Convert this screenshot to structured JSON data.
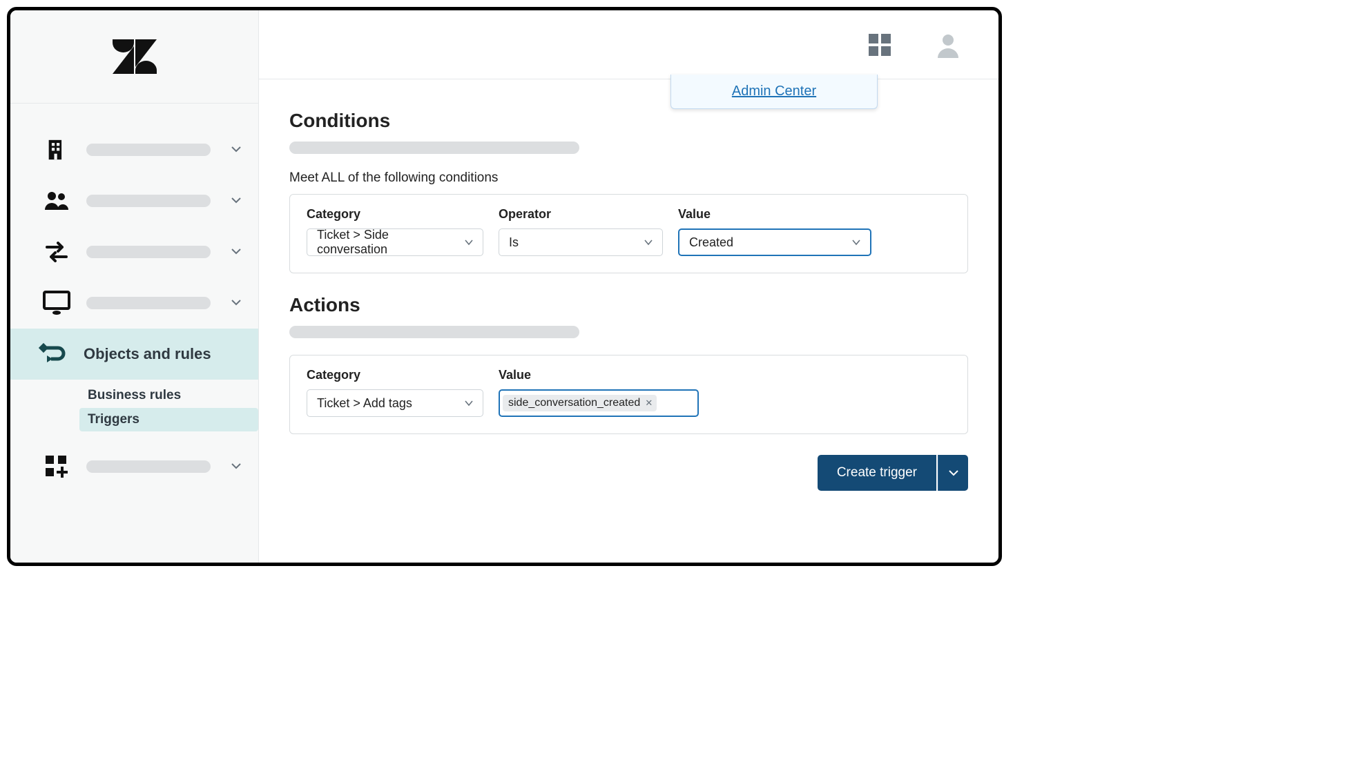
{
  "header": {
    "admin_center_link": "Admin Center"
  },
  "sidebar": {
    "active_item_label": "Objects and rules",
    "subnav": {
      "heading": "Business rules",
      "selected": "Triggers"
    }
  },
  "conditions": {
    "title": "Conditions",
    "meet_all_label": "Meet ALL of the following conditions",
    "columns": {
      "category": "Category",
      "operator": "Operator",
      "value": "Value"
    },
    "row": {
      "category": "Ticket > Side conversation",
      "operator": "Is",
      "value": "Created"
    }
  },
  "actions": {
    "title": "Actions",
    "columns": {
      "category": "Category",
      "value": "Value"
    },
    "row": {
      "category": "Ticket > Add tags",
      "tag": "side_conversation_created"
    }
  },
  "buttons": {
    "create": "Create trigger"
  }
}
